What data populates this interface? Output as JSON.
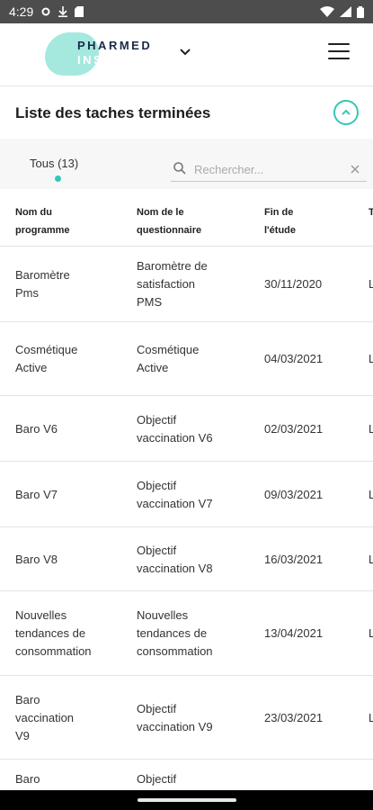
{
  "status_bar": {
    "time": "4:29",
    "icons": [
      "settings-icon",
      "download-icon",
      "sd-card-icon"
    ],
    "right_icons": [
      "wifi-icon",
      "signal-icon",
      "battery-icon"
    ]
  },
  "header": {
    "logo_line1": "PHARMED",
    "logo_line2": "INSIGHT",
    "brand_color": "#8fe3d6"
  },
  "section": {
    "title": "Liste des taches terminées",
    "accent": "#35c7b3"
  },
  "filter": {
    "tab_label": "Tous (13)",
    "search_placeholder": "Rechercher..."
  },
  "table": {
    "headers": [
      "Nom du\nprogramme",
      "Nom de le\nquestionnaire",
      "Fin de\nl'étude",
      "T"
    ],
    "rows": [
      {
        "program": "Baromètre\nPms",
        "questionnaire": "Baromètre de\nsatisfaction\nPMS",
        "end": "30/11/2020",
        "extra": "L"
      },
      {
        "program": "Cosmétique\nActive",
        "questionnaire": "Cosmétique\nActive",
        "end": "04/03/2021",
        "extra": "L"
      },
      {
        "program": "Baro V6",
        "questionnaire": "Objectif\nvaccination V6",
        "end": "02/03/2021",
        "extra": "L"
      },
      {
        "program": "Baro V7",
        "questionnaire": "Objectif\nvaccination V7",
        "end": "09/03/2021",
        "extra": "L"
      },
      {
        "program": "Baro V8",
        "questionnaire": "Objectif\nvaccination V8",
        "end": "16/03/2021",
        "extra": "L"
      },
      {
        "program": "Nouvelles\ntendances de\nconsommation",
        "questionnaire": "Nouvelles\ntendances de\nconsommation",
        "end": "13/04/2021",
        "extra": "L"
      },
      {
        "program": "Baro\nvaccination\nV9",
        "questionnaire": "Objectif\nvaccination V9",
        "end": "23/03/2021",
        "extra": "L"
      },
      {
        "program": "Baro",
        "questionnaire": "Objectif",
        "end": "",
        "extra": ""
      }
    ]
  }
}
